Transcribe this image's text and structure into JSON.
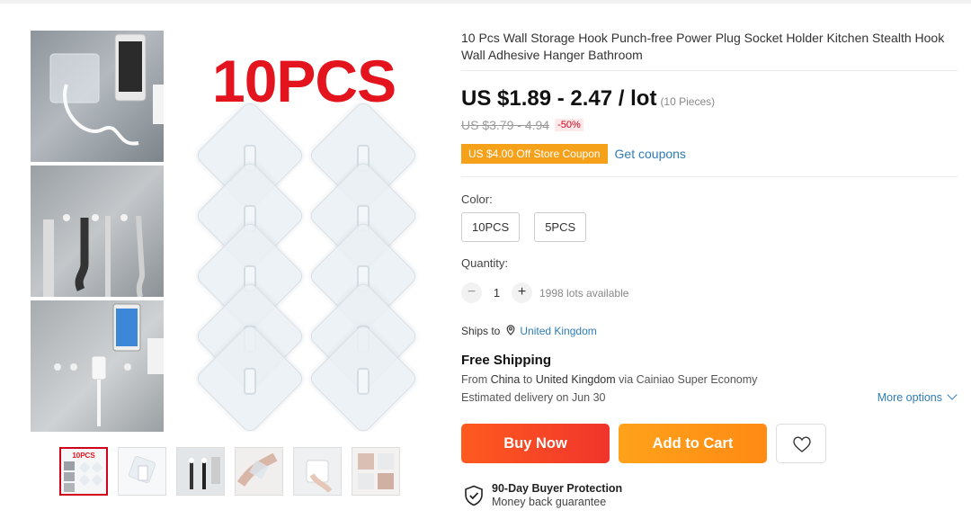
{
  "gallery": {
    "main_image_label": "10PCS",
    "thumb_labels": [
      "10PCS"
    ],
    "thumbnails_count": 6
  },
  "product": {
    "title": "10 Pcs Wall Storage Hook Punch-free Power Plug Socket Holder Kitchen Stealth Hook Wall Adhesive Hanger Bathroom",
    "price": "US $1.89 - 2.47 / lot",
    "price_unit": "(10 Pieces)",
    "original_price": "US $3.79 - 4.94",
    "discount": "-50%",
    "coupon_tag": "US $4.00 Off Store Coupon",
    "get_coupons": "Get coupons"
  },
  "color": {
    "label": "Color:",
    "options": [
      "10PCS",
      "5PCS"
    ]
  },
  "quantity": {
    "label": "Quantity:",
    "minus": "−",
    "value": "1",
    "plus": "+",
    "available": "1998 lots available"
  },
  "shipping": {
    "ships_to_label": "Ships to",
    "country": "United Kingdom",
    "free_shipping": "Free Shipping",
    "from_prefix": "From",
    "from_country": "China",
    "to_word": "to",
    "to_country": "United Kingdom",
    "via": "via Cainiao Super Economy",
    "estimated": "Estimated delivery on Jun 30",
    "more_options": "More options"
  },
  "actions": {
    "buy_now": "Buy Now",
    "add_to_cart": "Add to Cart"
  },
  "protection": {
    "title": "90-Day Buyer Protection",
    "subtitle": "Money back guarantee"
  },
  "colors": {
    "accent_red": "#d0021b",
    "buy_now": "#f0352c",
    "add_to_cart": "#ff8a14",
    "link_blue": "#2e7cb7",
    "coupon_orange": "#f6a11a"
  }
}
